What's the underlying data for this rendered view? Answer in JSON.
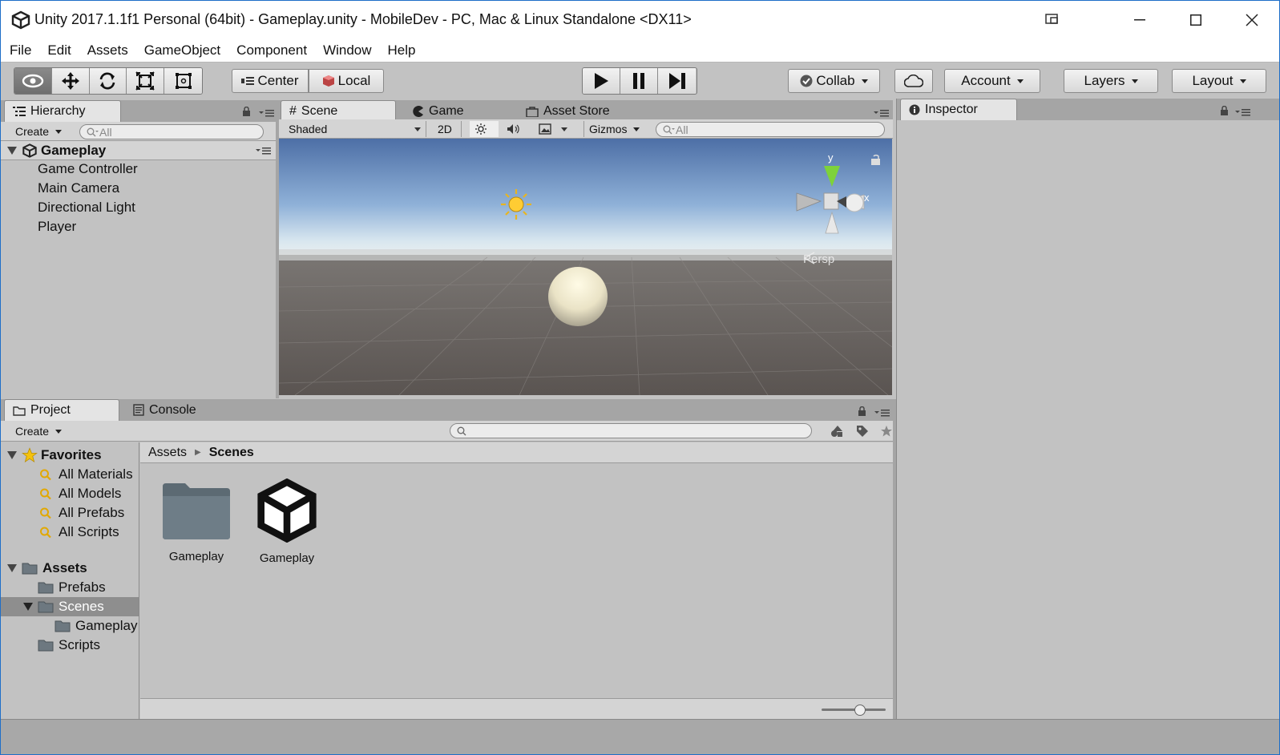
{
  "window": {
    "title": "Unity 2017.1.1f1 Personal (64bit) - Gameplay.unity - MobileDev - PC, Mac & Linux Standalone <DX11>",
    "controls": [
      "minimize",
      "maximize",
      "close"
    ]
  },
  "menu": [
    "File",
    "Edit",
    "Assets",
    "GameObject",
    "Component",
    "Window",
    "Help"
  ],
  "toolbar": {
    "transform_tools": [
      "view-tool-icon",
      "move-tool-icon",
      "rotate-tool-icon",
      "scale-tool-icon",
      "rect-tool-icon"
    ],
    "pivot_mode": "Center",
    "pivot_rotation": "Local",
    "play_controls": [
      "play-icon",
      "pause-icon",
      "step-icon"
    ],
    "collab": "Collab",
    "account": "Account",
    "layers": "Layers",
    "layout": "Layout"
  },
  "hierarchy": {
    "tab": "Hierarchy",
    "create": "Create",
    "search_placeholder": "All",
    "scene": "Gameplay",
    "items": [
      "Game Controller",
      "Main Camera",
      "Directional Light",
      "Player"
    ]
  },
  "scene_view": {
    "tabs": [
      "Scene",
      "Game",
      "Asset Store"
    ],
    "draw_mode": "Shaded",
    "mode_2d": "2D",
    "gizmos": "Gizmos",
    "search_placeholder": "All",
    "gizmo_y": "y",
    "gizmo_x": "x",
    "projection": "Persp"
  },
  "inspector": {
    "tab": "Inspector"
  },
  "project": {
    "tabs": [
      "Project",
      "Console"
    ],
    "create": "Create",
    "favorites_label": "Favorites",
    "favorites": [
      "All Materials",
      "All Models",
      "All Prefabs",
      "All Scripts"
    ],
    "assets_label": "Assets",
    "assets_tree": [
      {
        "label": "Prefabs",
        "depth": 1
      },
      {
        "label": "Scenes",
        "depth": 1,
        "selected": true
      },
      {
        "label": "Gameplay",
        "depth": 2
      },
      {
        "label": "Scripts",
        "depth": 1
      }
    ],
    "breadcrumb": [
      "Assets",
      "Scenes"
    ],
    "files": [
      {
        "name": "Gameplay",
        "icon": "folder-icon"
      },
      {
        "name": "Gameplay",
        "icon": "unity-scene-icon"
      }
    ],
    "zoom": 0.6
  },
  "colors": {
    "accent": "#1e6ec8",
    "selection": "#8e8e8e",
    "panel": "#c2c2c2"
  }
}
